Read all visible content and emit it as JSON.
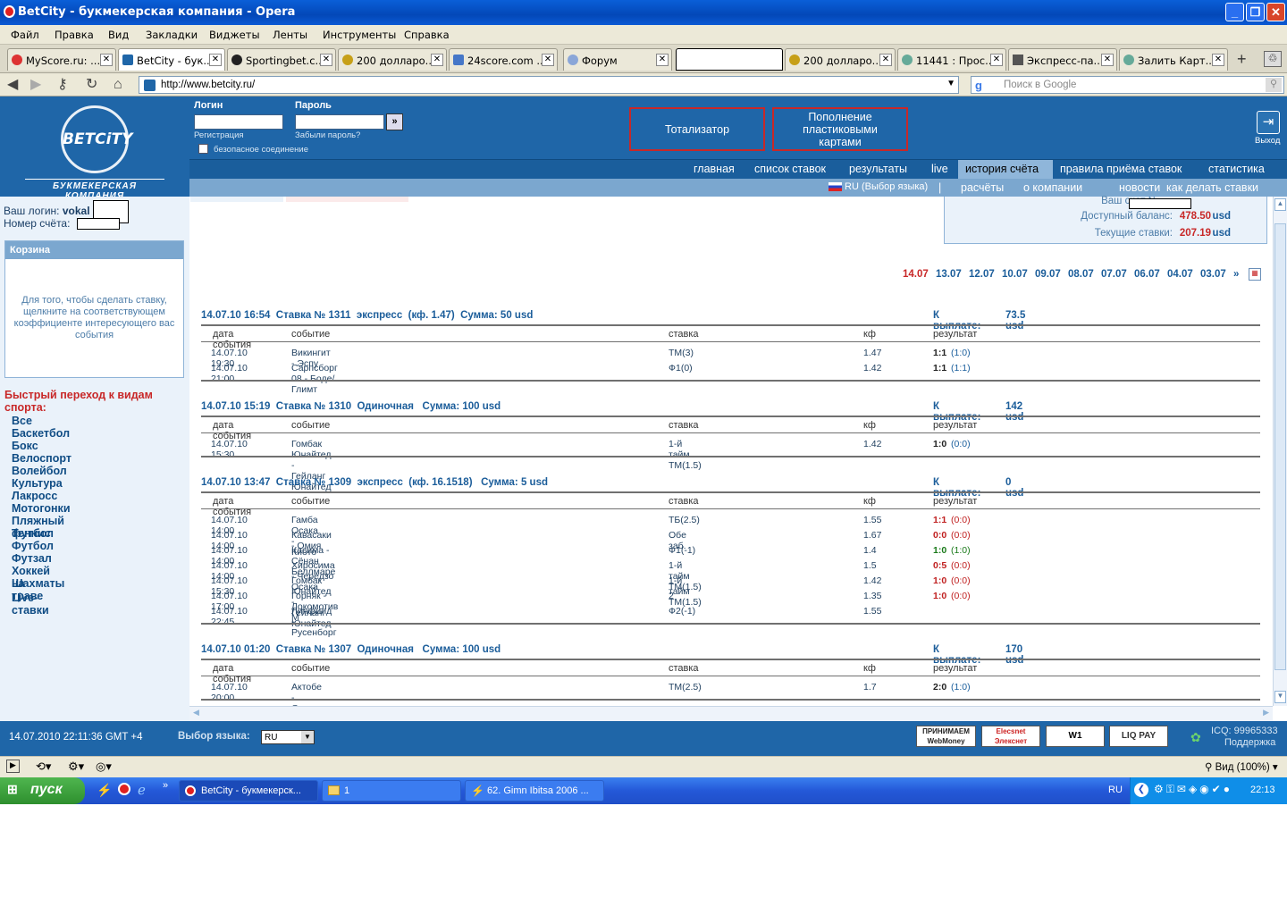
{
  "window": {
    "title": "BetCity - букмекерская компания - Opera"
  },
  "menu": [
    "Файл",
    "Правка",
    "Вид",
    "Закладки",
    "Виджеты",
    "Ленты",
    "Инструменты",
    "Справка"
  ],
  "tabs": [
    "MyScore.ru: ...",
    "BetCity - бук...",
    "Sportingbet.c...",
    "200 долларо...",
    "24score.com ...",
    "Форум",
    "",
    "200 долларо...",
    "11441 : Прос...",
    "Экспресс-па...",
    "Залить Карт..."
  ],
  "address": {
    "url": "http://www.betcity.ru/",
    "search_placeholder": "Поиск в Google"
  },
  "site": {
    "logo_name": "BETCiTY",
    "logo_sub": "БУКМЕКЕРСКАЯ КОМПАНИЯ",
    "login_label": "Логин",
    "password_label": "Пароль",
    "register": "Регистрация",
    "forgot": "Забыли пароль?",
    "secure": "безопасное соединение",
    "btn_totalizator": "Тотализатор",
    "btn_topup": "Пополнение пластиковыми картами",
    "exit": "Выход",
    "nav1": [
      "главная",
      "список ставок",
      "результаты",
      "live",
      "история счёта",
      "правила приёма ставок",
      "статистика"
    ],
    "lang": "RU (Выбор языка)",
    "nav2": [
      "расчёты",
      "о компании",
      "новости",
      "как делать ставки"
    ]
  },
  "left": {
    "login_prefix": "Ваш логин:",
    "login": "vokal",
    "account_label": "Номер счёта:",
    "cart_title": "Корзина",
    "cart_text": "Для того, чтобы сделать ставку, щелкните на соответствующем коэффициенте интересующего вас события",
    "quick_title": "Быстрый переход к видам спорта:",
    "sports": [
      "Все",
      "Баскетбол",
      "Бокс",
      "Велоспорт",
      "Волейбол",
      "Культура",
      "Лакросс",
      "Мотогонки",
      "Пляжный футбол",
      "Теннис",
      "Футбол",
      "Футзал",
      "Хоккей на траве",
      "Шахматы",
      "Live-ставки"
    ]
  },
  "balance": {
    "account_label": "Ваш счет №",
    "available_label": "Доступный баланс:",
    "available": "478.50",
    "current_label": "Текущие ставки:",
    "current": "207.19",
    "currency": "usd"
  },
  "dates": [
    "14.07",
    "13.07",
    "12.07",
    "10.07",
    "09.07",
    "08.07",
    "07.07",
    "06.07",
    "04.07",
    "03.07",
    "»"
  ],
  "columns": [
    "дата события",
    "событие",
    "ставка",
    "кф",
    "результат"
  ],
  "payout_label": "К выплате:",
  "bets": [
    {
      "head": "14.07.10 16:54  Ставка № 1311  экспресс  (кф. 1.47)  Сумма: 50 usd",
      "payout": "73.5 usd",
      "rows": [
        [
          "14.07.10 19:30",
          "Викингит - Эспу",
          "ТМ(3)",
          "1.47",
          "1:1",
          "(1:0)"
        ],
        [
          "14.07.10 21:00",
          "Сарпсборг 08 - Боде/Глимт",
          "Ф1(0)",
          "1.42",
          "1:1",
          "(1:1)"
        ]
      ]
    },
    {
      "head": "14.07.10 15:19  Ставка № 1310  Одиночная   Сумма: 100 usd",
      "payout": "142 usd",
      "rows": [
        [
          "14.07.10 15:30",
          "Гомбак Юнайтед - Гейланг Юнайтед",
          "1-й тайм ТМ(1.5)",
          "1.42",
          "1:0",
          "(0:0)"
        ]
      ]
    },
    {
      "head": "14.07.10 13:47  Ставка № 1309  экспресс  (кф. 16.1518)   Сумма: 5 usd",
      "payout": "0 usd",
      "rows": [
        [
          "14.07.10 14:00",
          "Гамба Осака - Киото",
          "ТБ(2.5)",
          "1.55",
          "1:1",
          "(0:0)"
        ],
        [
          "14.07.10 14:00",
          "Кавасаки - Омия",
          "Обе заб.",
          "1.67",
          "0:0",
          "(0:0)"
        ],
        [
          "14.07.10 14:00",
          "Касима - Сёнан Беллмаре",
          "Ф1(-1)",
          "1.4",
          "1:0",
          "(1:0)"
        ],
        [
          "14.07.10 14:00",
          "Хиросима - Чередзо Осака",
          "1-й тайм ТМ(1.5)",
          "1.5",
          "0:5",
          "(0:0)"
        ],
        [
          "14.07.10 15:30",
          "Гомбак Юнайтед - Гейланг Юнайтед",
          "1-й тайм ТМ(1.5)",
          "1.42",
          "1:0",
          "(0:0)"
        ],
        [
          "14.07.10 17:00",
          "Горняк - Локомотив М",
          "2",
          "1.35",
          "1:0",
          "(0:0)"
        ],
        [
          "14.07.10 22:45",
          "Линфилд - Русенборг",
          "Ф2(-1)",
          "1.55",
          "",
          ""
        ]
      ]
    },
    {
      "head": "14.07.10 01:20  Ставка № 1307  Одиночная   Сумма: 100 usd",
      "payout": "170 usd",
      "rows": [
        [
          "14.07.10 20:00",
          "Актобе - Олимпи Рустави",
          "ТМ(2.5)",
          "1.7",
          "2:0",
          "(1:0)"
        ]
      ]
    }
  ],
  "footer": {
    "datetime": "14.07.2010  22:11:36  GMT +4",
    "lang_label": "Выбор языка:",
    "lang_value": "RU",
    "icq": "ICQ: 99965333",
    "support": "Поддержка"
  },
  "status": {
    "zoom": "Вид (100%)"
  },
  "taskbar": {
    "start": "пуск",
    "items": [
      "BetCity - букмекерск...",
      "1",
      "62. Gimn Ibitsa 2006 ..."
    ],
    "lang": "RU",
    "clock": "22:13"
  }
}
